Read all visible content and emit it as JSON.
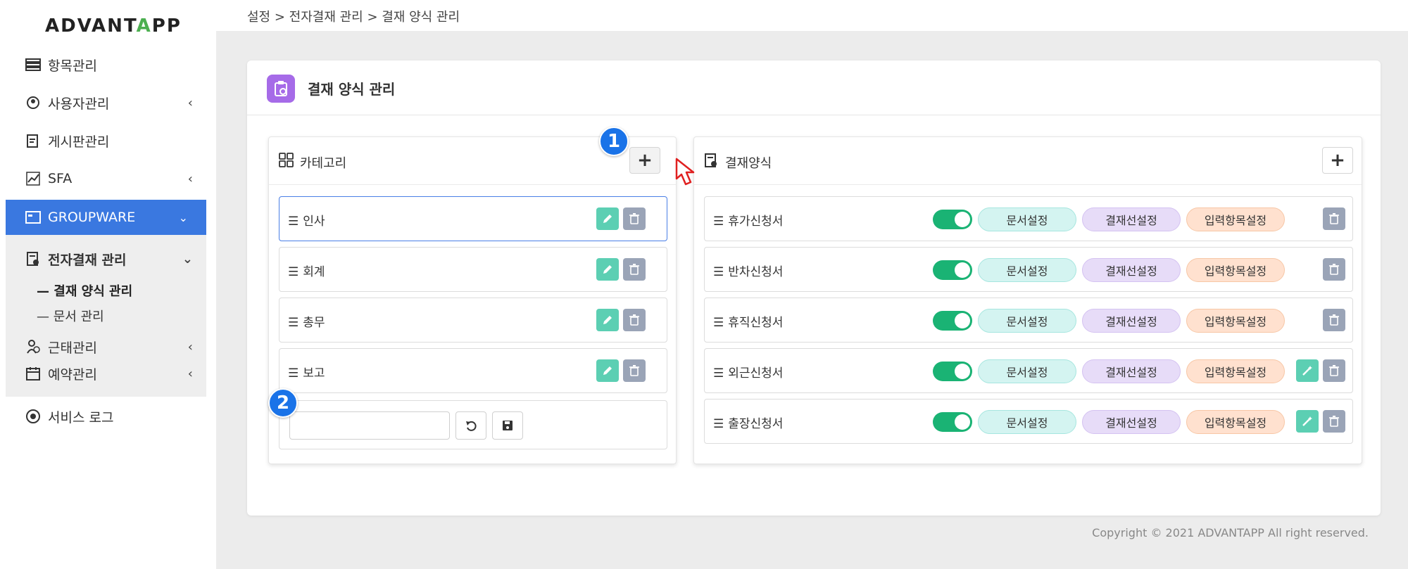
{
  "logo": {
    "text_a": "ADVANT",
    "text_mark": "A",
    "text_b": "PP"
  },
  "sidebar": {
    "items": [
      {
        "label": "항목관리",
        "icon": "list-icon"
      },
      {
        "label": "사용자관리",
        "icon": "user-settings-icon"
      },
      {
        "label": "게시판관리",
        "icon": "board-icon"
      },
      {
        "label": "SFA",
        "icon": "chart-icon"
      }
    ],
    "groupware": {
      "label": "GROUPWARE",
      "icon": "monitor-icon"
    },
    "approval": {
      "label": "전자결재 관리",
      "icon": "document-icon"
    },
    "sub_items": [
      "— 결재 양식 관리",
      "— 문서 관리"
    ],
    "more": [
      {
        "label": "근태관리",
        "icon": "attendance-icon"
      },
      {
        "label": "예약관리",
        "icon": "calendar-icon"
      }
    ],
    "service_log": {
      "label": "서비스 로그",
      "icon": "target-icon"
    }
  },
  "breadcrumb": "설정 > 전자결재 관리 > 결재 양식 관리",
  "page": {
    "title": "결재 양식 관리",
    "icon_color": "#a66be8"
  },
  "category_panel": {
    "title": "카테고리",
    "add_label": "+",
    "rows": [
      "인사",
      "회계",
      "총무",
      "보고"
    ],
    "new_input_value": ""
  },
  "form_panel": {
    "title": "결재양식",
    "add_label": "+",
    "pill_labels": {
      "doc": "문서설정",
      "line": "결재선설정",
      "input": "입력항목설정"
    },
    "rows": [
      {
        "name": "휴가신청서",
        "enabled": true,
        "wand": false
      },
      {
        "name": "반차신청서",
        "enabled": true,
        "wand": false
      },
      {
        "name": "휴직신청서",
        "enabled": true,
        "wand": false
      },
      {
        "name": "외근신청서",
        "enabled": true,
        "wand": true
      },
      {
        "name": "출장신청서",
        "enabled": true,
        "wand": true
      }
    ]
  },
  "markers": [
    "1",
    "2"
  ],
  "copyright": "Copyright © 2021 ADVANTAPP All right reserved.",
  "colors": {
    "accent": "#3a78e0",
    "toggle_on": "#1ab374",
    "marker": "#1a73e8"
  }
}
